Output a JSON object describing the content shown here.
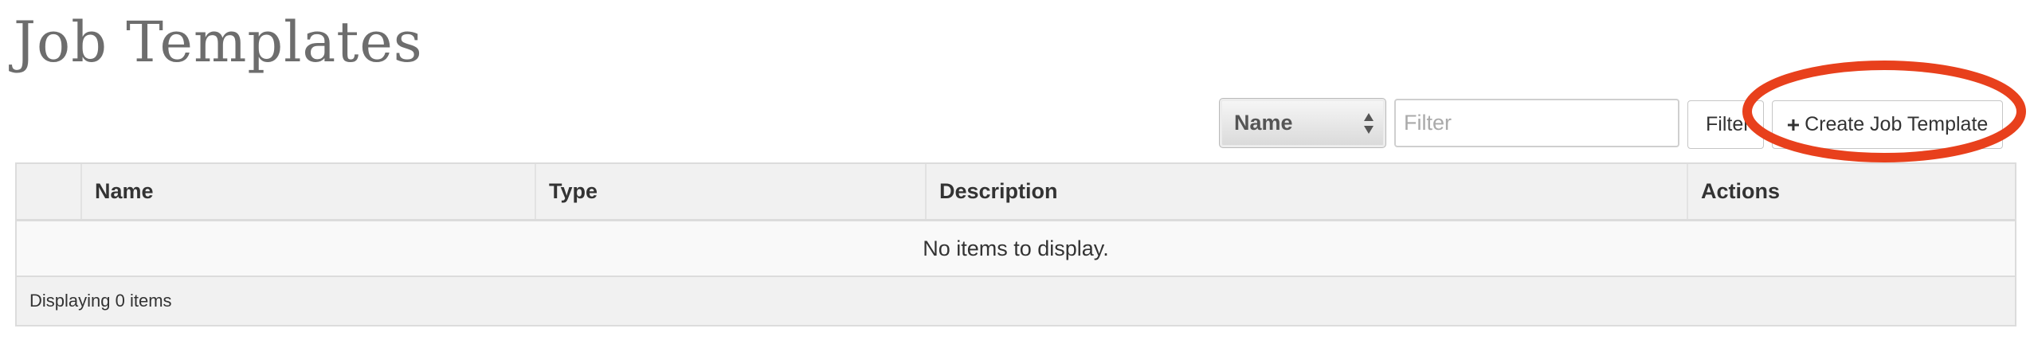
{
  "page": {
    "title": "Job Templates"
  },
  "toolbar": {
    "filter_field_selected": "Name",
    "filter_placeholder": "Filter",
    "filter_button_label": "Filter",
    "create_button_label": "Create Job Template",
    "create_button_icon": "plus-icon"
  },
  "annotation": {
    "highlight_color": "#e8401c"
  },
  "table": {
    "columns": [
      "",
      "Name",
      "Type",
      "Description",
      "Actions"
    ],
    "empty_message": "No items to display.",
    "footer_text": "Displaying 0 items"
  }
}
